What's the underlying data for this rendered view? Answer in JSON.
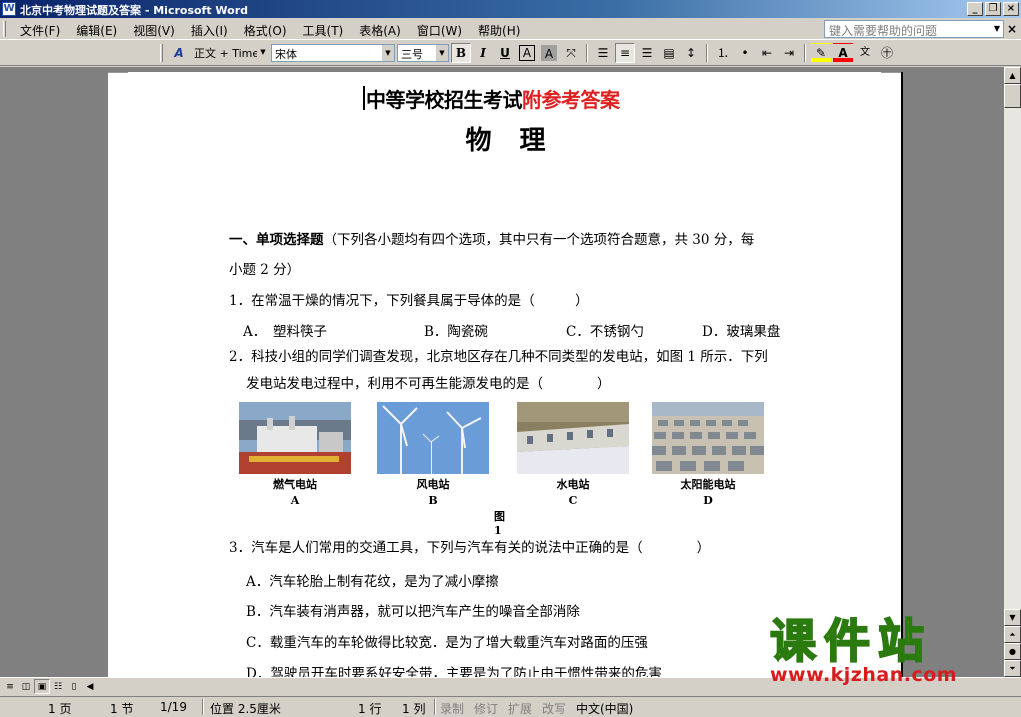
{
  "window": {
    "title": "北京中考物理试题及答案 - Microsoft Word",
    "minimize": "_",
    "restore": "❐",
    "close": "×"
  },
  "menubar": {
    "items": [
      "文件(F)",
      "编辑(E)",
      "视图(V)",
      "插入(I)",
      "格式(O)",
      "工具(T)",
      "表格(A)",
      "窗口(W)",
      "帮助(H)"
    ],
    "help_placeholder": "键入需要帮助的问题",
    "close_doc": "×"
  },
  "toolbar": {
    "style_value": "正文 + Time",
    "font_value": "宋体",
    "size_value": "三号",
    "bold": "B",
    "italic": "I",
    "underline": "U",
    "char_border": "A",
    "char_shade": "A",
    "font_color": "A",
    "align_active": "center"
  },
  "document": {
    "title_black": "中等学校招生考试",
    "title_red": "附参考答案",
    "subject": "物理",
    "section_heading": "一、单项选择题",
    "section_desc": "（下列各小题均有四个选项，其中只有一个选项符合题意，共 30 分，每",
    "section_desc2": "小题 2 分）",
    "q1": "1．在常温干燥的情况下，下列餐具属于导体的是（　　　）",
    "q1_options": [
      "A．　塑料筷子",
      "B．陶瓷碗",
      "C．不锈钢勺",
      "D．玻璃果盘"
    ],
    "q2_line1": "2．科技小组的同学们调查发现，北京地区存在几种不同类型的发电站，如图 1 所示．下列",
    "q2_line2": "发电站发电过程中，利用不可再生能源发电的是（　　　　）",
    "figures": [
      {
        "caption": "燃气电站",
        "letter": "A"
      },
      {
        "caption": "风电站",
        "letter": "B"
      },
      {
        "caption": "水电站",
        "letter": "C"
      },
      {
        "caption": "太阳能电站",
        "letter": "D"
      }
    ],
    "figure_label": "图1",
    "q3": "3．汽车是人们常用的交通工具，下列与汽车有关的说法中正确的是（　　　　）",
    "q3_options": [
      "A．汽车轮胎上制有花纹，是为了减小摩擦",
      "B．汽车装有消声器，就可以把汽车产生的噪音全部消除",
      "C．载重汽车的车轮做得比较宽．是为了增大载重汽车对路面的压强",
      "D．驾驶员开车时要系好安全带，主要是为了防止由于惯性带来的危害"
    ]
  },
  "statusbar": {
    "page": "1 页",
    "section": "1 节",
    "page_of": "1/19",
    "position": "位置 2.5厘米",
    "line": "1 行",
    "column": "1 列",
    "rec": "录制",
    "trk": "修订",
    "ext": "扩展",
    "ovr": "改写",
    "language": "中文(中国)"
  },
  "watermark": {
    "text": "课件站",
    "url": "www.kjzhan.com"
  }
}
